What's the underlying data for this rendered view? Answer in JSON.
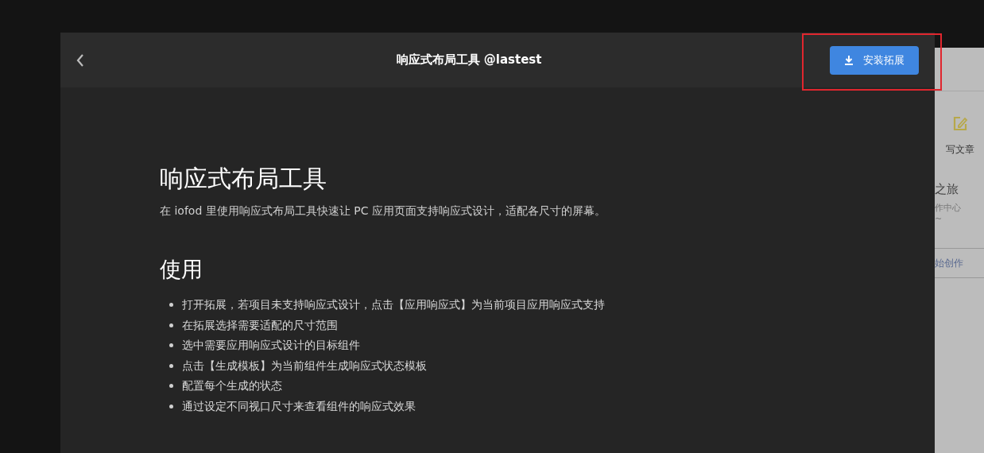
{
  "dialog": {
    "title": "响应式布局工具 @lastest",
    "install_button": {
      "label": "安装拓展",
      "highlighted": true
    }
  },
  "content": {
    "heading": "响应式布局工具",
    "intro": "在 iofod 里使用响应式布局工具快速让 PC 应用页面支持响应式设计，适配各尺寸的屏幕。",
    "section_heading": "使用",
    "steps": [
      "打开拓展，若项目未支持响应式设计，点击【应用响应式】为当前项目应用响应式支持",
      "在拓展选择需要适配的尺寸范围",
      "选中需要应用响应式设计的目标组件",
      "点击【生成模板】为当前组件生成响应式状态模板",
      "配置每个生成的状态",
      "通过设定不同视口尺寸来查看组件的响应式效果"
    ]
  },
  "background_page": {
    "write_label": "写文章",
    "card_title": "之旅",
    "card_subtitle": "作中心",
    "card_note": "~",
    "card_link": "始创作"
  }
}
